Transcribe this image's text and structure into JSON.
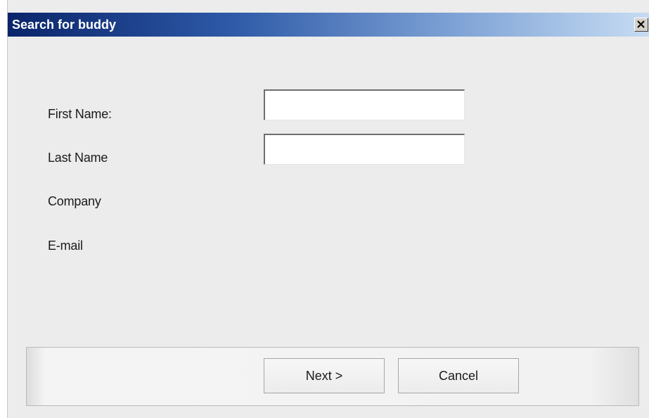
{
  "window": {
    "title": "Search for buddy",
    "close_glyph": "✕",
    "close_icon": "close-icon"
  },
  "form": {
    "first_name": {
      "label": "First Name:",
      "value": "",
      "placeholder": ""
    },
    "last_name": {
      "label": "Last Name",
      "value": "",
      "placeholder": ""
    },
    "company": {
      "label": "Company"
    },
    "email": {
      "label": "E-mail"
    }
  },
  "buttons": {
    "next_label": "Next >",
    "cancel_label": "Cancel"
  },
  "colors": {
    "title_gradient_start": "#0a246a",
    "title_gradient_end": "#c6dcf3",
    "dialog_background": "#ececec"
  }
}
